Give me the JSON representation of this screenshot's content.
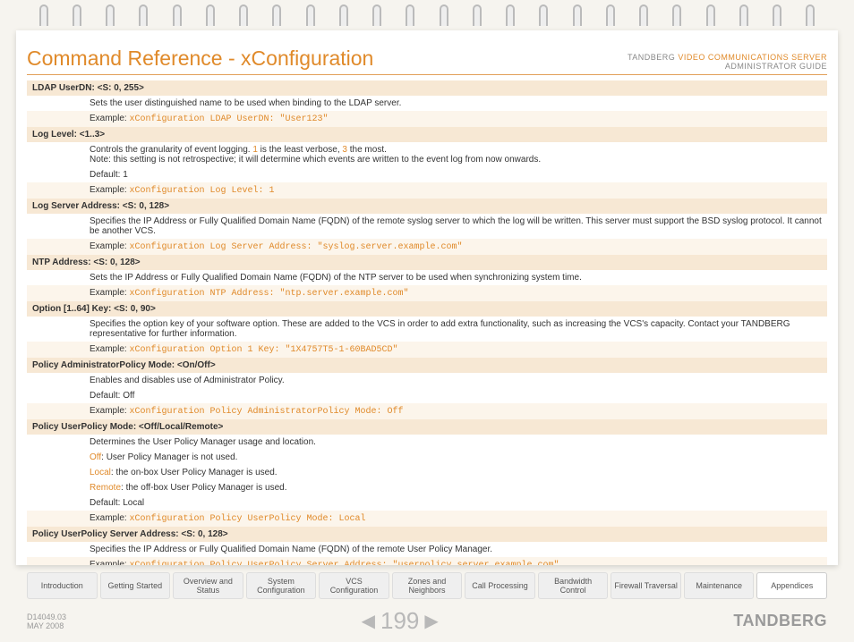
{
  "header": {
    "title": "Command Reference - xConfiguration",
    "company": "TANDBERG",
    "product": "VIDEO COMMUNICATIONS SERVER",
    "guide": "ADMINISTRATOR GUIDE"
  },
  "entries": [
    {
      "header": "LDAP UserDN: <S: 0, 255>",
      "desc": "Sets the user distinguished name to be used when binding to the LDAP server.",
      "example_label": "Example:",
      "example_code": "xConfiguration LDAP UserDN: \"User123\""
    },
    {
      "header": "Log Level: <1..3>",
      "desc_parts": [
        {
          "t": "Controls the granularity of event logging. "
        },
        {
          "t": "1",
          "cls": "orange"
        },
        {
          "t": " is the least verbose, "
        },
        {
          "t": "3",
          "cls": "orange"
        },
        {
          "t": " the most."
        }
      ],
      "note": "Note: this setting is not retrospective; it will determine which events are written to the event log from now onwards.",
      "default": "Default: 1",
      "example_label": "Example:",
      "example_code": "xConfiguration Log Level: 1"
    },
    {
      "header": "Log Server Address: <S: 0, 128>",
      "desc": "Specifies the IP Address or Fully Qualified Domain Name (FQDN) of the remote syslog server to which the log will be written. This server must support the BSD syslog protocol. It cannot be another VCS.",
      "example_label": "Example:",
      "example_code": "xConfiguration Log Server Address: \"syslog.server.example.com\""
    },
    {
      "header": "NTP Address: <S: 0, 128>",
      "desc": "Sets the IP Address or Fully Qualified Domain Name (FQDN) of the NTP server to be used when synchronizing system time.",
      "example_label": "Example:",
      "example_code": "xConfiguration NTP Address: \"ntp.server.example.com\""
    },
    {
      "header": "Option [1..64] Key: <S: 0, 90>",
      "desc": "Specifies the option key of your software option. These are added to the VCS in order to add extra functionality, such as increasing the VCS's capacity. Contact your TANDBERG representative for further information.",
      "example_label": "Example:",
      "example_code": "xConfiguration Option 1 Key: \"1X4757T5-1-60BAD5CD\""
    },
    {
      "header": "Policy AdministratorPolicy Mode: <On/Off>",
      "desc": "Enables and disables use of Administrator Policy.",
      "default": "Default: Off",
      "example_label": "Example:",
      "example_code": "xConfiguration Policy AdministratorPolicy Mode: Off"
    },
    {
      "header": "Policy UserPolicy Mode: <Off/Local/Remote>",
      "desc": "Determines the User Policy Manager usage and location.",
      "opts": [
        {
          "k": "Off",
          "v": ": User Policy Manager is not used."
        },
        {
          "k": "Local",
          "v": ": the on-box User Policy Manager is used."
        },
        {
          "k": "Remote",
          "v": ": the off-box User Policy Manager is used."
        }
      ],
      "default": "Default: Local",
      "example_label": "Example:",
      "example_code": "xConfiguration Policy UserPolicy Mode: Local"
    },
    {
      "header": "Policy UserPolicy Server Address: <S: 0, 128>",
      "desc": "Specifies the IP Address or Fully Qualified Domain Name (FQDN) of the remote User Policy Manager.",
      "example_label": "Example:",
      "example_code": "xConfiguration Policy UserPolicy Server Address: \"userpolicy.server.example.com\""
    }
  ],
  "tabs": [
    "Introduction",
    "Getting Started",
    "Overview and Status",
    "System Configuration",
    "VCS Configuration",
    "Zones and Neighbors",
    "Call Processing",
    "Bandwidth Control",
    "Firewall Traversal",
    "Maintenance",
    "Appendices"
  ],
  "active_tab": 10,
  "footer": {
    "docid": "D14049.03",
    "date": "MAY 2008",
    "page": "199",
    "brand": "TANDBERG"
  }
}
